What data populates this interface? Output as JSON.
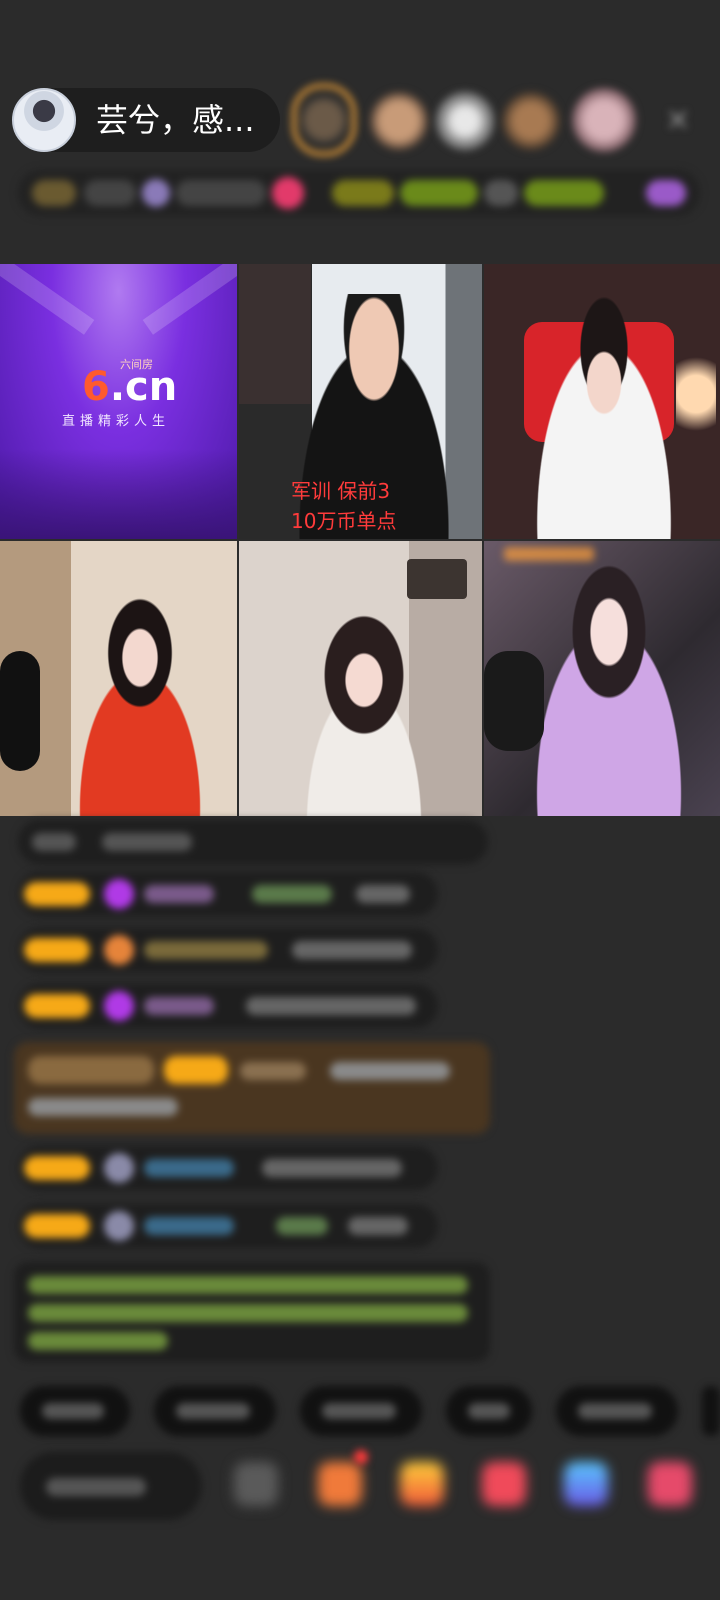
{
  "header": {
    "host_name": "芸兮，感...",
    "close_icon": "×"
  },
  "video_grid": {
    "brand_tile": {
      "logo_main": "6",
      "logo_suffix": ".cn",
      "logo_brand_small": "六间房",
      "slogan": "直播精彩人生"
    },
    "tile_2_caption_line_1": "军训 保前3",
    "tile_2_caption_line_2": "10万币单点"
  },
  "colors": {
    "background": "#2b2b2b",
    "accent_badge": "#f6a917",
    "caption_red": "#ff3b3b",
    "brand_purple": "#7a2fe0"
  },
  "icons": {
    "close": "close-icon",
    "gift": "gift-icon",
    "more": "more-icon"
  }
}
